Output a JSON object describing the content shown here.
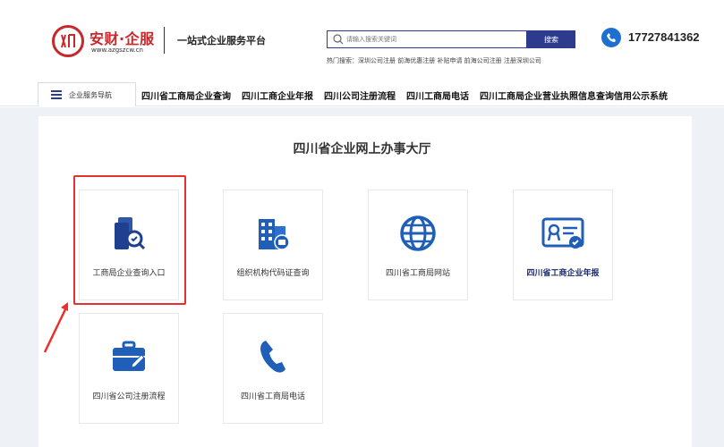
{
  "header": {
    "brand_name": "安财·企服",
    "brand_url": "www.azgszcw.cn",
    "slogan": "一站式企业服务平台",
    "search_placeholder": "请输入搜索关键词",
    "search_button": "搜索",
    "hot_search": "热门搜索：深圳公司注册 前海优惠注册 补贴申请 前海公司注册 注册深圳公司",
    "phone": "17727841362",
    "brand_color": "#c8282b",
    "accent_color": "#2e3a8c"
  },
  "nav": {
    "menu_label": "企业服务导航",
    "links": [
      "四川省工商局企业查询",
      "四川工商企业年报",
      "四川公司注册流程",
      "四川工商局电话",
      "四川工商局企业营业执照信息查询信用公示系统"
    ]
  },
  "main": {
    "title": "四川省企业网上办事大厅",
    "cards": [
      {
        "label": "工商局企业查询入口",
        "icon": "document-search-icon"
      },
      {
        "label": "组织机构代码证查询",
        "icon": "building-icon"
      },
      {
        "label": "四川省工商局网站",
        "icon": "globe-icon"
      },
      {
        "label": "四川省工商企业年报",
        "icon": "certificate-icon"
      },
      {
        "label": "四川省公司注册流程",
        "icon": "briefcase-icon"
      },
      {
        "label": "四川省工商局电话",
        "icon": "phone-icon"
      }
    ]
  }
}
